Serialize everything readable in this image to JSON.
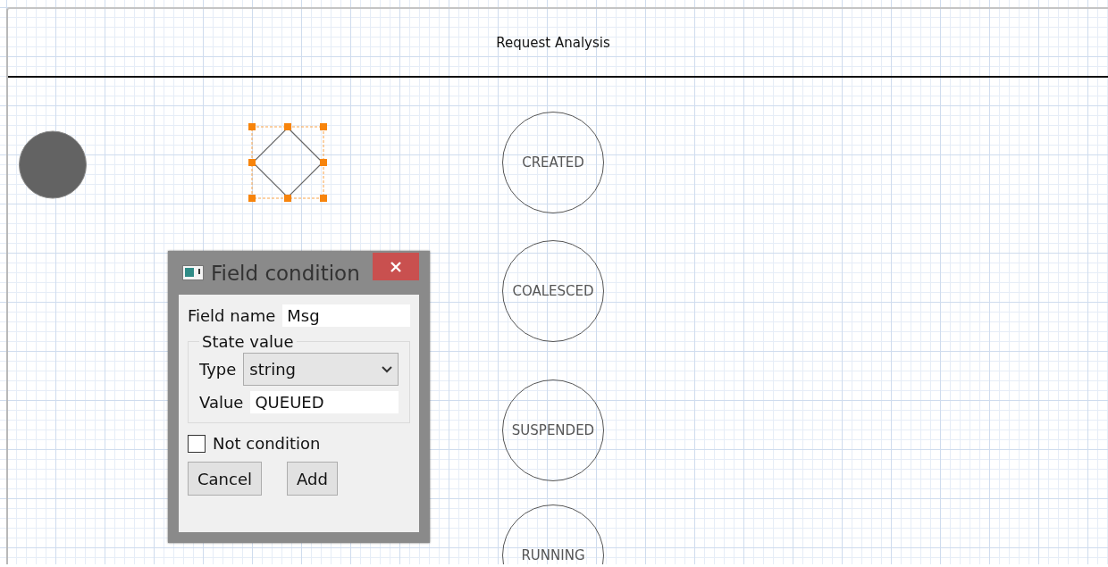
{
  "diagram": {
    "pool": {
      "title": "Request Analysis"
    },
    "nodes": [
      {
        "kind": "start"
      },
      {
        "kind": "gateway",
        "selected": true
      },
      {
        "kind": "state",
        "label": "CREATED"
      },
      {
        "kind": "state",
        "label": "COALESCED"
      },
      {
        "kind": "state",
        "label": "SUSPENDED"
      },
      {
        "kind": "state",
        "label": "RUNNING"
      }
    ]
  },
  "dialog": {
    "title": "Field condition",
    "field_name": {
      "label": "Field name",
      "value": "Msg"
    },
    "group": {
      "title": "State value",
      "type": {
        "label": "Type",
        "value": "string"
      },
      "value": {
        "label": "Value",
        "value": "QUEUED"
      }
    },
    "not_condition": {
      "label": "Not condition",
      "checked": false
    },
    "buttons": [
      "Cancel",
      "Add"
    ]
  }
}
